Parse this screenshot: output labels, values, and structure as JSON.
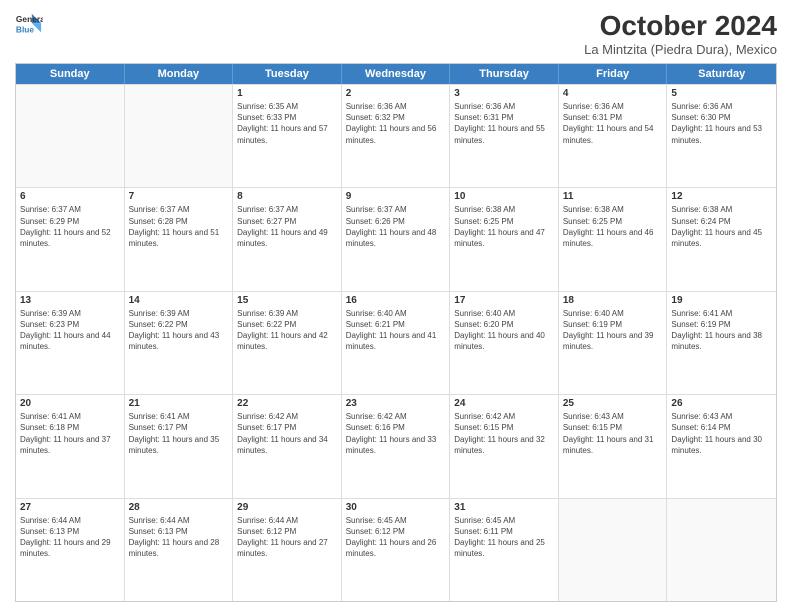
{
  "header": {
    "logo_line1": "General",
    "logo_line2": "Blue",
    "title": "October 2024",
    "subtitle": "La Mintzita (Piedra Dura), Mexico"
  },
  "weekdays": [
    "Sunday",
    "Monday",
    "Tuesday",
    "Wednesday",
    "Thursday",
    "Friday",
    "Saturday"
  ],
  "weeks": [
    [
      {
        "day": "",
        "sunrise": "",
        "sunset": "",
        "daylight": ""
      },
      {
        "day": "",
        "sunrise": "",
        "sunset": "",
        "daylight": ""
      },
      {
        "day": "1",
        "sunrise": "Sunrise: 6:35 AM",
        "sunset": "Sunset: 6:33 PM",
        "daylight": "Daylight: 11 hours and 57 minutes."
      },
      {
        "day": "2",
        "sunrise": "Sunrise: 6:36 AM",
        "sunset": "Sunset: 6:32 PM",
        "daylight": "Daylight: 11 hours and 56 minutes."
      },
      {
        "day": "3",
        "sunrise": "Sunrise: 6:36 AM",
        "sunset": "Sunset: 6:31 PM",
        "daylight": "Daylight: 11 hours and 55 minutes."
      },
      {
        "day": "4",
        "sunrise": "Sunrise: 6:36 AM",
        "sunset": "Sunset: 6:31 PM",
        "daylight": "Daylight: 11 hours and 54 minutes."
      },
      {
        "day": "5",
        "sunrise": "Sunrise: 6:36 AM",
        "sunset": "Sunset: 6:30 PM",
        "daylight": "Daylight: 11 hours and 53 minutes."
      }
    ],
    [
      {
        "day": "6",
        "sunrise": "Sunrise: 6:37 AM",
        "sunset": "Sunset: 6:29 PM",
        "daylight": "Daylight: 11 hours and 52 minutes."
      },
      {
        "day": "7",
        "sunrise": "Sunrise: 6:37 AM",
        "sunset": "Sunset: 6:28 PM",
        "daylight": "Daylight: 11 hours and 51 minutes."
      },
      {
        "day": "8",
        "sunrise": "Sunrise: 6:37 AM",
        "sunset": "Sunset: 6:27 PM",
        "daylight": "Daylight: 11 hours and 49 minutes."
      },
      {
        "day": "9",
        "sunrise": "Sunrise: 6:37 AM",
        "sunset": "Sunset: 6:26 PM",
        "daylight": "Daylight: 11 hours and 48 minutes."
      },
      {
        "day": "10",
        "sunrise": "Sunrise: 6:38 AM",
        "sunset": "Sunset: 6:25 PM",
        "daylight": "Daylight: 11 hours and 47 minutes."
      },
      {
        "day": "11",
        "sunrise": "Sunrise: 6:38 AM",
        "sunset": "Sunset: 6:25 PM",
        "daylight": "Daylight: 11 hours and 46 minutes."
      },
      {
        "day": "12",
        "sunrise": "Sunrise: 6:38 AM",
        "sunset": "Sunset: 6:24 PM",
        "daylight": "Daylight: 11 hours and 45 minutes."
      }
    ],
    [
      {
        "day": "13",
        "sunrise": "Sunrise: 6:39 AM",
        "sunset": "Sunset: 6:23 PM",
        "daylight": "Daylight: 11 hours and 44 minutes."
      },
      {
        "day": "14",
        "sunrise": "Sunrise: 6:39 AM",
        "sunset": "Sunset: 6:22 PM",
        "daylight": "Daylight: 11 hours and 43 minutes."
      },
      {
        "day": "15",
        "sunrise": "Sunrise: 6:39 AM",
        "sunset": "Sunset: 6:22 PM",
        "daylight": "Daylight: 11 hours and 42 minutes."
      },
      {
        "day": "16",
        "sunrise": "Sunrise: 6:40 AM",
        "sunset": "Sunset: 6:21 PM",
        "daylight": "Daylight: 11 hours and 41 minutes."
      },
      {
        "day": "17",
        "sunrise": "Sunrise: 6:40 AM",
        "sunset": "Sunset: 6:20 PM",
        "daylight": "Daylight: 11 hours and 40 minutes."
      },
      {
        "day": "18",
        "sunrise": "Sunrise: 6:40 AM",
        "sunset": "Sunset: 6:19 PM",
        "daylight": "Daylight: 11 hours and 39 minutes."
      },
      {
        "day": "19",
        "sunrise": "Sunrise: 6:41 AM",
        "sunset": "Sunset: 6:19 PM",
        "daylight": "Daylight: 11 hours and 38 minutes."
      }
    ],
    [
      {
        "day": "20",
        "sunrise": "Sunrise: 6:41 AM",
        "sunset": "Sunset: 6:18 PM",
        "daylight": "Daylight: 11 hours and 37 minutes."
      },
      {
        "day": "21",
        "sunrise": "Sunrise: 6:41 AM",
        "sunset": "Sunset: 6:17 PM",
        "daylight": "Daylight: 11 hours and 35 minutes."
      },
      {
        "day": "22",
        "sunrise": "Sunrise: 6:42 AM",
        "sunset": "Sunset: 6:17 PM",
        "daylight": "Daylight: 11 hours and 34 minutes."
      },
      {
        "day": "23",
        "sunrise": "Sunrise: 6:42 AM",
        "sunset": "Sunset: 6:16 PM",
        "daylight": "Daylight: 11 hours and 33 minutes."
      },
      {
        "day": "24",
        "sunrise": "Sunrise: 6:42 AM",
        "sunset": "Sunset: 6:15 PM",
        "daylight": "Daylight: 11 hours and 32 minutes."
      },
      {
        "day": "25",
        "sunrise": "Sunrise: 6:43 AM",
        "sunset": "Sunset: 6:15 PM",
        "daylight": "Daylight: 11 hours and 31 minutes."
      },
      {
        "day": "26",
        "sunrise": "Sunrise: 6:43 AM",
        "sunset": "Sunset: 6:14 PM",
        "daylight": "Daylight: 11 hours and 30 minutes."
      }
    ],
    [
      {
        "day": "27",
        "sunrise": "Sunrise: 6:44 AM",
        "sunset": "Sunset: 6:13 PM",
        "daylight": "Daylight: 11 hours and 29 minutes."
      },
      {
        "day": "28",
        "sunrise": "Sunrise: 6:44 AM",
        "sunset": "Sunset: 6:13 PM",
        "daylight": "Daylight: 11 hours and 28 minutes."
      },
      {
        "day": "29",
        "sunrise": "Sunrise: 6:44 AM",
        "sunset": "Sunset: 6:12 PM",
        "daylight": "Daylight: 11 hours and 27 minutes."
      },
      {
        "day": "30",
        "sunrise": "Sunrise: 6:45 AM",
        "sunset": "Sunset: 6:12 PM",
        "daylight": "Daylight: 11 hours and 26 minutes."
      },
      {
        "day": "31",
        "sunrise": "Sunrise: 6:45 AM",
        "sunset": "Sunset: 6:11 PM",
        "daylight": "Daylight: 11 hours and 25 minutes."
      },
      {
        "day": "",
        "sunrise": "",
        "sunset": "",
        "daylight": ""
      },
      {
        "day": "",
        "sunrise": "",
        "sunset": "",
        "daylight": ""
      }
    ]
  ]
}
